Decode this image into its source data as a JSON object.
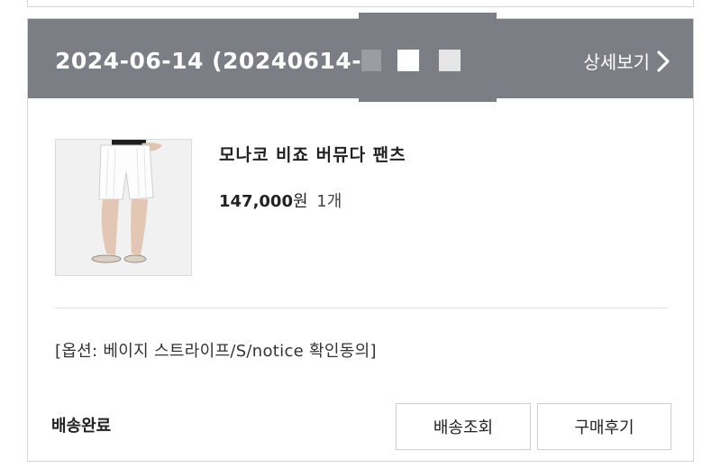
{
  "order": {
    "date_text": "2024-06-14 (20240614-",
    "detail_label": "상세보기",
    "detail_icon": "chevron-right-icon"
  },
  "product": {
    "image_icon": "product-photo-white-shorts",
    "name": "모나코 비죠 버뮤다 팬츠",
    "price": "147,000",
    "currency": "원",
    "quantity": "1개",
    "option": "[옵션: 베이지 스트라이프/S/notice 확인동의]"
  },
  "status": {
    "label": "배송완료"
  },
  "actions": {
    "track_label": "배송조회",
    "review_label": "구매후기"
  },
  "colors": {
    "header_bg": "#7b7e85",
    "border": "#d6d6d6"
  }
}
